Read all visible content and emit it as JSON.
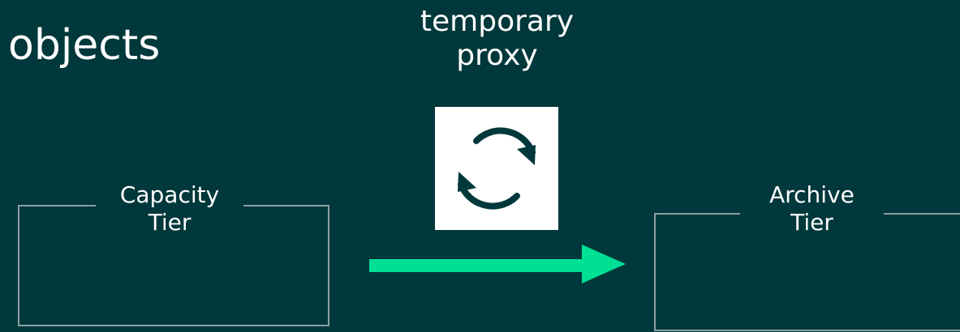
{
  "heading": "objects",
  "proxy": {
    "label_line1": "temporary",
    "label_line2": "proxy",
    "icon": "sync-icon"
  },
  "tiers": {
    "capacity": {
      "line1": "Capacity",
      "line2": "Tier"
    },
    "archive": {
      "line1": "Archive",
      "line2": "Tier"
    }
  },
  "arrow": {
    "icon": "right-arrow-icon",
    "color": "#00e094"
  },
  "colors": {
    "background": "#01383b",
    "text": "#ffffff",
    "box_border": "#8a9fa1",
    "icon_box": "#ffffff",
    "icon": "#01383b",
    "arrow": "#00e094"
  }
}
